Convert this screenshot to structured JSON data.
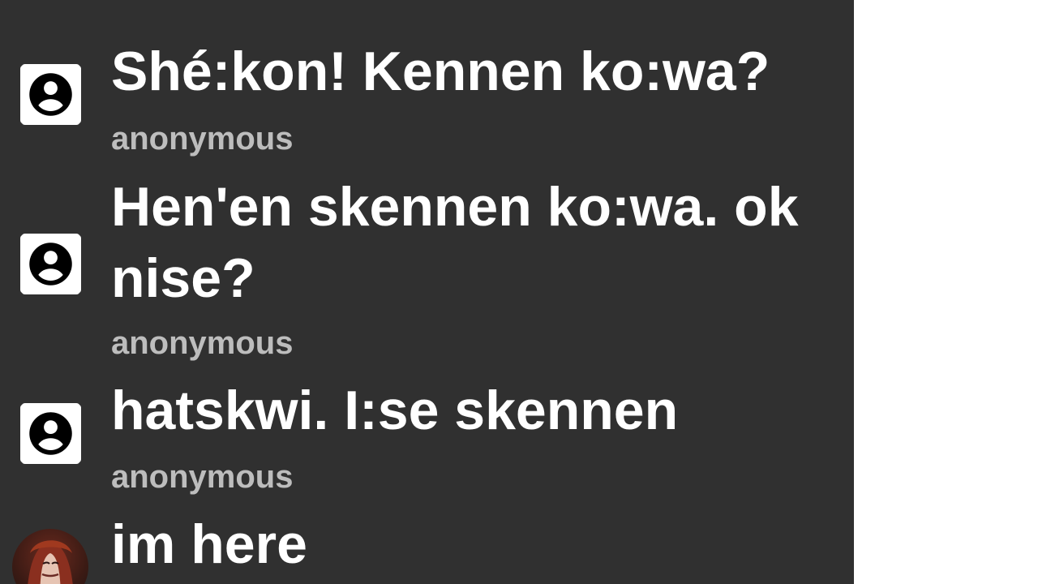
{
  "messages": [
    {
      "text": "Shé:kon! Kennen ko:wa?",
      "author": "anonymous",
      "avatar": "user-circle-icon"
    },
    {
      "text": "Hen'en skennen ko:wa. ok nise?",
      "author": "anonymous",
      "avatar": "user-circle-icon"
    },
    {
      "text": "hatskwi. I:se skennen",
      "author": "anonymous",
      "avatar": "user-circle-icon"
    },
    {
      "text": "im here",
      "author": "",
      "avatar": "profile-photo"
    }
  ]
}
